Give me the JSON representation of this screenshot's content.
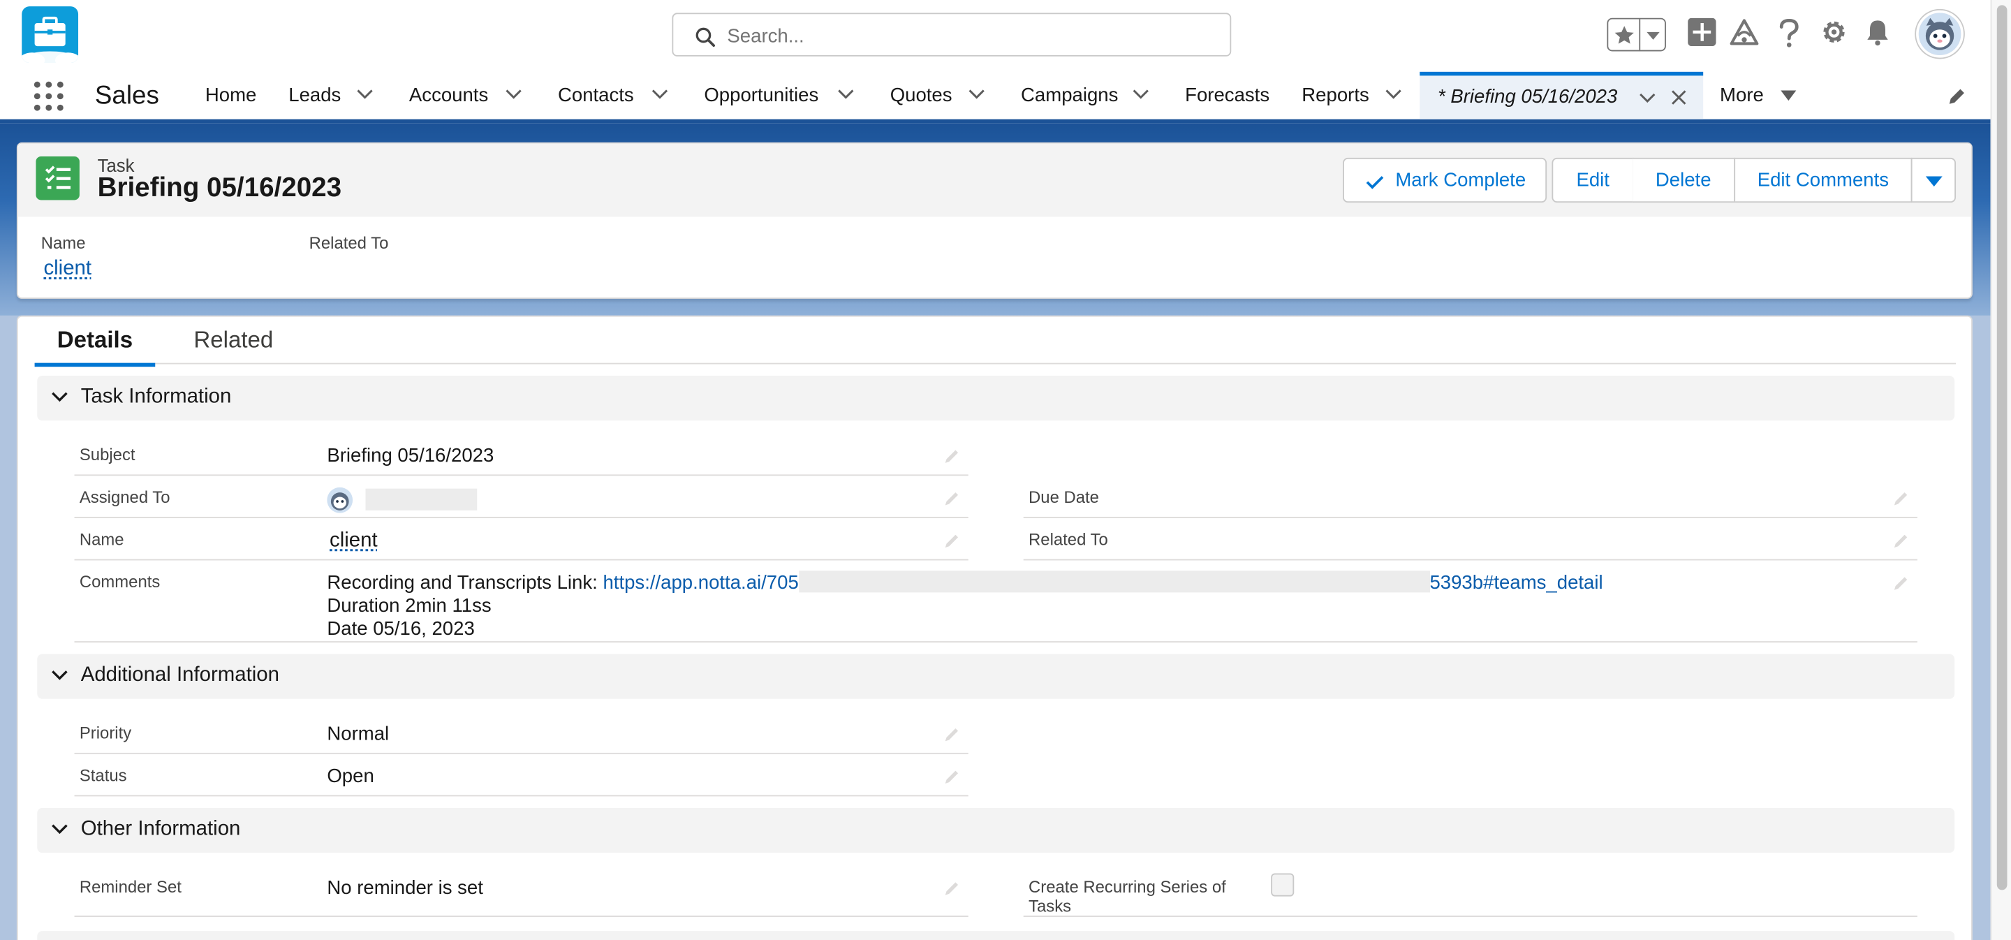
{
  "header": {
    "search_placeholder": "Search...",
    "icons": [
      "favorites-star-icon",
      "add-icon",
      "trailhead-icon",
      "help-icon",
      "setup-gear-icon",
      "notification-bell-icon",
      "user-avatar"
    ]
  },
  "nav": {
    "app_name": "Sales",
    "items": [
      {
        "label": "Home"
      },
      {
        "label": "Leads"
      },
      {
        "label": "Accounts"
      },
      {
        "label": "Contacts"
      },
      {
        "label": "Opportunities"
      },
      {
        "label": "Quotes"
      },
      {
        "label": "Campaigns"
      },
      {
        "label": "Forecasts"
      },
      {
        "label": "Reports"
      }
    ],
    "active_tab": "* Briefing 05/16/2023",
    "more": "More"
  },
  "record": {
    "entity": "Task",
    "title": "Briefing 05/16/2023",
    "actions": {
      "mark_complete": "Mark Complete",
      "edit": "Edit",
      "delete": "Delete",
      "edit_comments": "Edit Comments"
    },
    "highlights": {
      "name_label": "Name",
      "name_value": "client",
      "related_label": "Related To"
    }
  },
  "tabs": {
    "details": "Details",
    "related": "Related"
  },
  "sections": {
    "task_info": {
      "title": "Task Information",
      "subject_label": "Subject",
      "subject_value": "Briefing 05/16/2023",
      "assigned_label": "Assigned To",
      "due_label": "Due Date",
      "name_label": "Name",
      "name_value": "client",
      "related_label": "Related To",
      "comments_label": "Comments",
      "comments_prefix": "Recording and Transcripts Link: ",
      "comments_link_start": "https://app.notta.ai/705",
      "comments_link_end": "5393b#teams_detail",
      "comments_line2": "Duration 2min 11ss",
      "comments_line3": "Date 05/16, 2023"
    },
    "additional_info": {
      "title": "Additional Information",
      "priority_label": "Priority",
      "priority_value": "Normal",
      "status_label": "Status",
      "status_value": "Open"
    },
    "other_info": {
      "title": "Other Information",
      "reminder_label": "Reminder Set",
      "reminder_value": "No reminder is set",
      "recurring_label": "Create Recurring Series of Tasks",
      "recurring_checked": false
    }
  },
  "colors": {
    "brand_blue": "#0176d3",
    "nav_border": "#1b5297",
    "task_icon_green": "#3ba755",
    "link": "#0b5cab"
  }
}
